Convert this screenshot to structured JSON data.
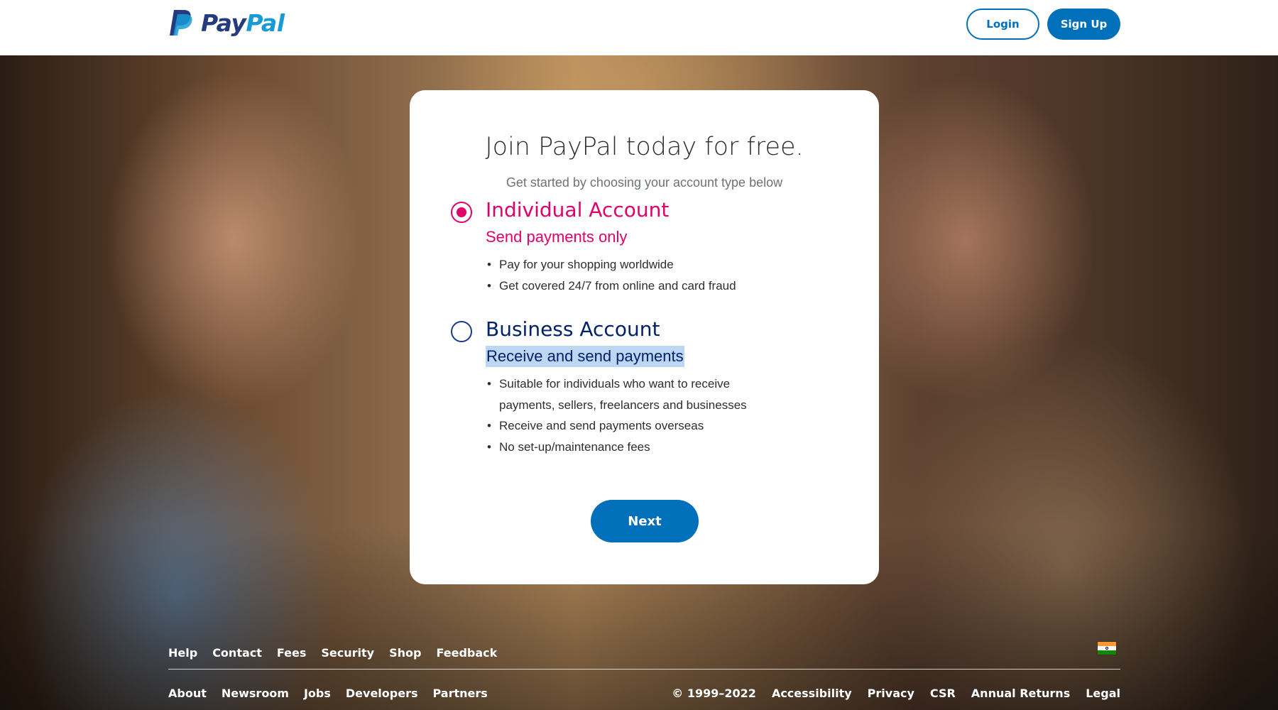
{
  "header": {
    "logo_text_pay": "Pay",
    "logo_text_pal": "Pal",
    "login_label": "Login",
    "signup_label": "Sign Up"
  },
  "card": {
    "title": "Join PayPal today for free.",
    "subtitle": "Get started by choosing your account type below",
    "options": [
      {
        "title": "Individual Account",
        "subtitle": "Send payments only",
        "selected": true,
        "bullets": [
          "Pay for your shopping worldwide",
          "Get covered 24/7 from online and card fraud"
        ]
      },
      {
        "title": "Business Account",
        "subtitle": "Receive and send payments",
        "selected": false,
        "bullets": [
          "Suitable for individuals who want to receive payments, sellers, freelancers and businesses",
          "Receive and send payments overseas",
          "No set-up/maintenance fees"
        ]
      }
    ],
    "next_label": "Next"
  },
  "footer": {
    "top_links": [
      "Help",
      "Contact",
      "Fees",
      "Security",
      "Shop",
      "Feedback"
    ],
    "bottom_links": [
      "About",
      "Newsroom",
      "Jobs",
      "Developers",
      "Partners"
    ],
    "copyright": "© 1999–2022",
    "right_links": [
      "Accessibility",
      "Privacy",
      "CSR",
      "Annual Returns",
      "Legal"
    ],
    "country_flag": "india-flag-icon"
  },
  "colors": {
    "brand_blue": "#0070ba",
    "logo_dark_blue": "#253b80",
    "logo_light_blue": "#179bd7",
    "individual_accent": "#e0006b",
    "business_accent": "#012169",
    "highlight": "#bcd6f4"
  }
}
